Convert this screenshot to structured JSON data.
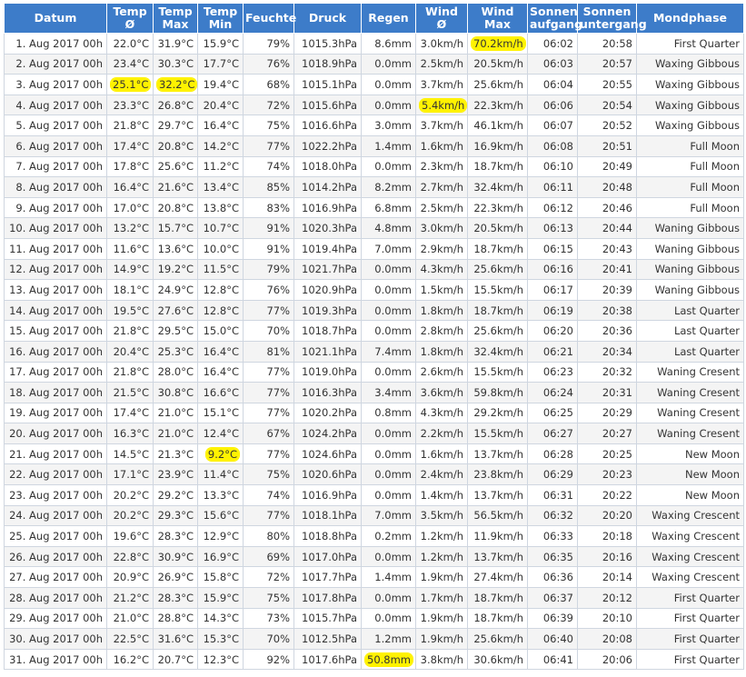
{
  "columns": [
    [
      "Datum"
    ],
    [
      "Temp",
      "Ø"
    ],
    [
      "Temp",
      "Max"
    ],
    [
      "Temp",
      "Min"
    ],
    [
      "Feuchte"
    ],
    [
      "Druck"
    ],
    [
      "Regen"
    ],
    [
      "Wind",
      "Ø"
    ],
    [
      "Wind",
      "Max"
    ],
    [
      "Sonnen",
      "aufgang"
    ],
    [
      "Sonnen",
      "untergang"
    ],
    [
      "Mondphase"
    ]
  ],
  "highlight_color": "#fff200",
  "header_color": "#3d7cc9",
  "rows": [
    [
      "1. Aug 2017 00h",
      "22.0°C",
      "31.9°C",
      "15.9°C",
      "79%",
      "1015.3hPa",
      "8.6mm",
      "3.0km/h",
      "70.2km/h",
      "06:02",
      "20:58",
      "First Quarter"
    ],
    [
      "2. Aug 2017 00h",
      "23.4°C",
      "30.3°C",
      "17.7°C",
      "76%",
      "1018.9hPa",
      "0.0mm",
      "2.5km/h",
      "20.5km/h",
      "06:03",
      "20:57",
      "Waxing Gibbous"
    ],
    [
      "3. Aug 2017 00h",
      "25.1°C",
      "32.2°C",
      "19.4°C",
      "68%",
      "1015.1hPa",
      "0.0mm",
      "3.7km/h",
      "25.6km/h",
      "06:04",
      "20:55",
      "Waxing Gibbous"
    ],
    [
      "4. Aug 2017 00h",
      "23.3°C",
      "26.8°C",
      "20.4°C",
      "72%",
      "1015.6hPa",
      "0.0mm",
      "5.4km/h",
      "22.3km/h",
      "06:06",
      "20:54",
      "Waxing Gibbous"
    ],
    [
      "5. Aug 2017 00h",
      "21.8°C",
      "29.7°C",
      "16.4°C",
      "75%",
      "1016.6hPa",
      "3.0mm",
      "3.7km/h",
      "46.1km/h",
      "06:07",
      "20:52",
      "Waxing Gibbous"
    ],
    [
      "6. Aug 2017 00h",
      "17.4°C",
      "20.8°C",
      "14.2°C",
      "77%",
      "1022.2hPa",
      "1.4mm",
      "1.6km/h",
      "16.9km/h",
      "06:08",
      "20:51",
      "Full Moon"
    ],
    [
      "7. Aug 2017 00h",
      "17.8°C",
      "25.6°C",
      "11.2°C",
      "74%",
      "1018.0hPa",
      "0.0mm",
      "2.3km/h",
      "18.7km/h",
      "06:10",
      "20:49",
      "Full Moon"
    ],
    [
      "8. Aug 2017 00h",
      "16.4°C",
      "21.6°C",
      "13.4°C",
      "85%",
      "1014.2hPa",
      "8.2mm",
      "2.7km/h",
      "32.4km/h",
      "06:11",
      "20:48",
      "Full Moon"
    ],
    [
      "9. Aug 2017 00h",
      "17.0°C",
      "20.8°C",
      "13.8°C",
      "83%",
      "1016.9hPa",
      "6.8mm",
      "2.5km/h",
      "22.3km/h",
      "06:12",
      "20:46",
      "Full Moon"
    ],
    [
      "10. Aug 2017 00h",
      "13.2°C",
      "15.7°C",
      "10.7°C",
      "91%",
      "1020.3hPa",
      "4.8mm",
      "3.0km/h",
      "20.5km/h",
      "06:13",
      "20:44",
      "Waning Gibbous"
    ],
    [
      "11. Aug 2017 00h",
      "11.6°C",
      "13.6°C",
      "10.0°C",
      "91%",
      "1019.4hPa",
      "7.0mm",
      "2.9km/h",
      "18.7km/h",
      "06:15",
      "20:43",
      "Waning Gibbous"
    ],
    [
      "12. Aug 2017 00h",
      "14.9°C",
      "19.2°C",
      "11.5°C",
      "79%",
      "1021.7hPa",
      "0.0mm",
      "4.3km/h",
      "25.6km/h",
      "06:16",
      "20:41",
      "Waning Gibbous"
    ],
    [
      "13. Aug 2017 00h",
      "18.1°C",
      "24.9°C",
      "12.8°C",
      "76%",
      "1020.9hPa",
      "0.0mm",
      "1.5km/h",
      "15.5km/h",
      "06:17",
      "20:39",
      "Waning Gibbous"
    ],
    [
      "14. Aug 2017 00h",
      "19.5°C",
      "27.6°C",
      "12.8°C",
      "77%",
      "1019.3hPa",
      "0.0mm",
      "1.8km/h",
      "18.7km/h",
      "06:19",
      "20:38",
      "Last Quarter"
    ],
    [
      "15. Aug 2017 00h",
      "21.8°C",
      "29.5°C",
      "15.0°C",
      "70%",
      "1018.7hPa",
      "0.0mm",
      "2.8km/h",
      "25.6km/h",
      "06:20",
      "20:36",
      "Last Quarter"
    ],
    [
      "16. Aug 2017 00h",
      "20.4°C",
      "25.3°C",
      "16.4°C",
      "81%",
      "1021.1hPa",
      "7.4mm",
      "1.8km/h",
      "32.4km/h",
      "06:21",
      "20:34",
      "Last Quarter"
    ],
    [
      "17. Aug 2017 00h",
      "21.8°C",
      "28.0°C",
      "16.4°C",
      "77%",
      "1019.0hPa",
      "0.0mm",
      "2.6km/h",
      "15.5km/h",
      "06:23",
      "20:32",
      "Waning Cresent"
    ],
    [
      "18. Aug 2017 00h",
      "21.5°C",
      "30.8°C",
      "16.6°C",
      "77%",
      "1016.3hPa",
      "3.4mm",
      "3.6km/h",
      "59.8km/h",
      "06:24",
      "20:31",
      "Waning Cresent"
    ],
    [
      "19. Aug 2017 00h",
      "17.4°C",
      "21.0°C",
      "15.1°C",
      "77%",
      "1020.2hPa",
      "0.8mm",
      "4.3km/h",
      "29.2km/h",
      "06:25",
      "20:29",
      "Waning Cresent"
    ],
    [
      "20. Aug 2017 00h",
      "16.3°C",
      "21.0°C",
      "12.4°C",
      "67%",
      "1024.2hPa",
      "0.0mm",
      "2.2km/h",
      "15.5km/h",
      "06:27",
      "20:27",
      "Waning Cresent"
    ],
    [
      "21. Aug 2017 00h",
      "14.5°C",
      "21.3°C",
      "9.2°C",
      "77%",
      "1024.6hPa",
      "0.0mm",
      "1.6km/h",
      "13.7km/h",
      "06:28",
      "20:25",
      "New Moon"
    ],
    [
      "22. Aug 2017 00h",
      "17.1°C",
      "23.9°C",
      "11.4°C",
      "75%",
      "1020.6hPa",
      "0.0mm",
      "2.4km/h",
      "23.8km/h",
      "06:29",
      "20:23",
      "New Moon"
    ],
    [
      "23. Aug 2017 00h",
      "20.2°C",
      "29.2°C",
      "13.3°C",
      "74%",
      "1016.9hPa",
      "0.0mm",
      "1.4km/h",
      "13.7km/h",
      "06:31",
      "20:22",
      "New Moon"
    ],
    [
      "24. Aug 2017 00h",
      "20.2°C",
      "29.3°C",
      "15.6°C",
      "77%",
      "1018.1hPa",
      "7.0mm",
      "3.5km/h",
      "56.5km/h",
      "06:32",
      "20:20",
      "Waxing Crescent"
    ],
    [
      "25. Aug 2017 00h",
      "19.6°C",
      "28.3°C",
      "12.9°C",
      "80%",
      "1018.8hPa",
      "0.2mm",
      "1.2km/h",
      "11.9km/h",
      "06:33",
      "20:18",
      "Waxing Crescent"
    ],
    [
      "26. Aug 2017 00h",
      "22.8°C",
      "30.9°C",
      "16.9°C",
      "69%",
      "1017.0hPa",
      "0.0mm",
      "1.2km/h",
      "13.7km/h",
      "06:35",
      "20:16",
      "Waxing Crescent"
    ],
    [
      "27. Aug 2017 00h",
      "20.9°C",
      "26.9°C",
      "15.8°C",
      "72%",
      "1017.7hPa",
      "1.4mm",
      "1.9km/h",
      "27.4km/h",
      "06:36",
      "20:14",
      "Waxing Crescent"
    ],
    [
      "28. Aug 2017 00h",
      "21.2°C",
      "28.3°C",
      "15.9°C",
      "75%",
      "1017.8hPa",
      "0.0mm",
      "1.7km/h",
      "18.7km/h",
      "06:37",
      "20:12",
      "First Quarter"
    ],
    [
      "29. Aug 2017 00h",
      "21.0°C",
      "28.8°C",
      "14.3°C",
      "73%",
      "1015.7hPa",
      "0.0mm",
      "1.9km/h",
      "18.7km/h",
      "06:39",
      "20:10",
      "First Quarter"
    ],
    [
      "30. Aug 2017 00h",
      "22.5°C",
      "31.6°C",
      "15.3°C",
      "70%",
      "1012.5hPa",
      "1.2mm",
      "1.9km/h",
      "25.6km/h",
      "06:40",
      "20:08",
      "First Quarter"
    ],
    [
      "31. Aug 2017 00h",
      "16.2°C",
      "20.7°C",
      "12.3°C",
      "92%",
      "1017.6hPa",
      "50.8mm",
      "3.8km/h",
      "30.6km/h",
      "06:41",
      "20:06",
      "First Quarter"
    ]
  ],
  "highlights": [
    [
      0,
      8
    ],
    [
      2,
      1
    ],
    [
      2,
      2
    ],
    [
      3,
      7
    ],
    [
      20,
      3
    ],
    [
      30,
      6
    ]
  ]
}
